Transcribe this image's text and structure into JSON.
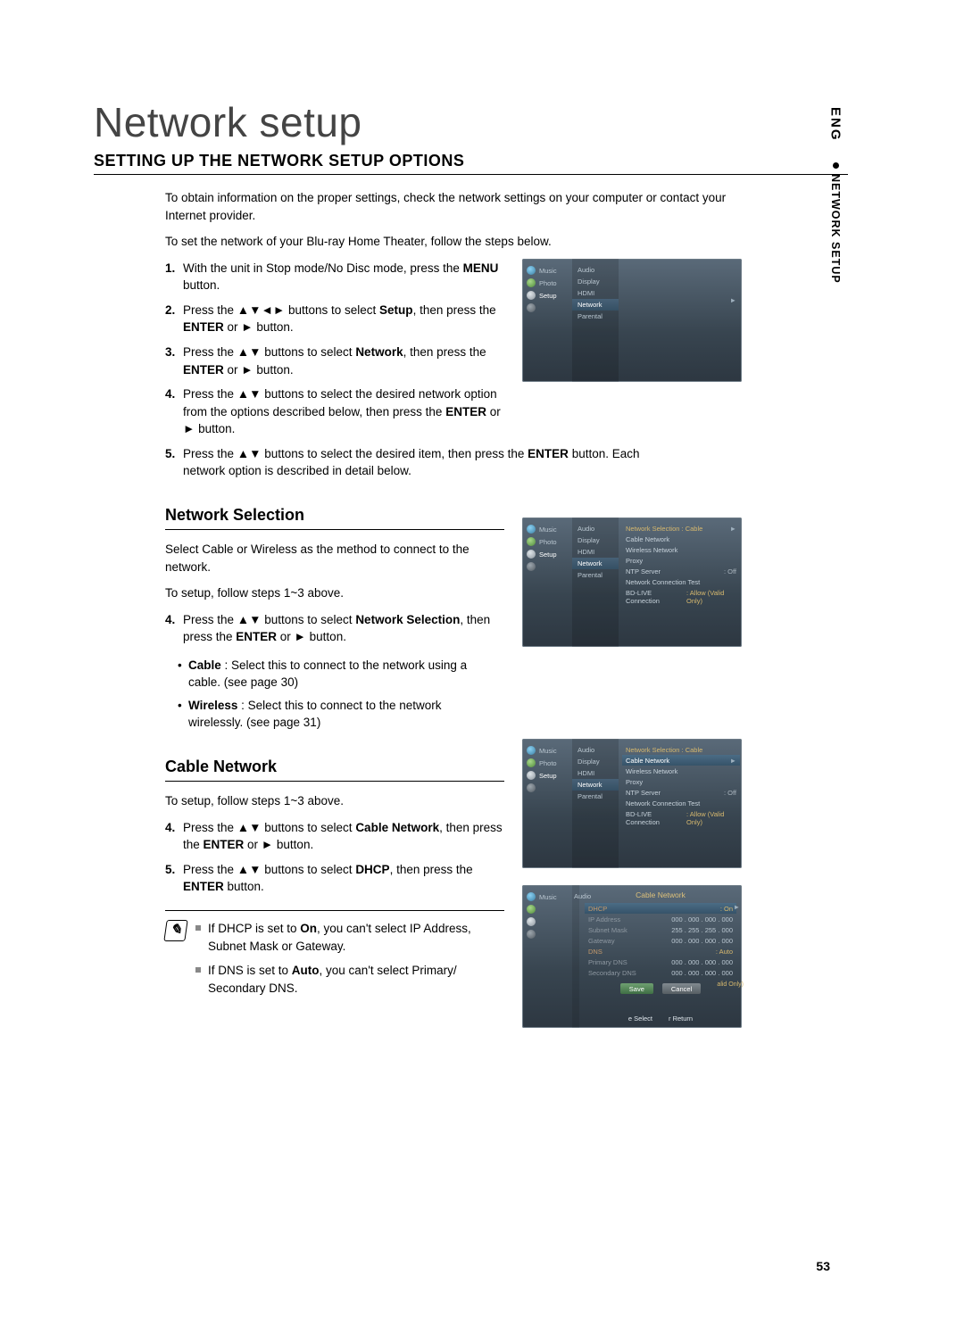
{
  "edge": {
    "lang": "ENG",
    "section": "NETWORK SETUP"
  },
  "title": "Network setup",
  "heading": "SETTING UP THE NETWORK SETUP OPTIONS",
  "intro1": "To obtain information on the proper settings, check the network settings on your computer or contact your Internet provider.",
  "intro2": "To set the network of your Blu-ray Home Theater, follow the steps below.",
  "steps_main": [
    {
      "n": "1.",
      "pre": "With the unit in Stop mode/No Disc mode, press the ",
      "b": "MENU",
      "post": " button."
    },
    {
      "n": "2.",
      "pre": "Press the ▲▼◄► buttons to select ",
      "b": "Setup",
      "post": ", then press the ENTER or ► button.",
      "boldTail": [
        "ENTER"
      ]
    },
    {
      "n": "3.",
      "pre": "Press the ▲▼ buttons to select ",
      "b": "Network",
      "post": ", then press the ENTER or ► button.",
      "boldTail": [
        "ENTER"
      ]
    },
    {
      "n": "4.",
      "pre": "Press the ▲▼ buttons to select the desired network option from the options described below, then press the ",
      "b": "ENTER",
      "post": " or ► button."
    },
    {
      "n": "5.",
      "pre": "Press the ▲▼ buttons to select the desired item, then press the ",
      "b": "ENTER",
      "post": " button. Each network option is described in detail below.",
      "wide": true
    }
  ],
  "net_sel": {
    "heading": "Network Selection",
    "p1": "Select Cable or Wireless as the method to connect to the network.",
    "p2": "To setup, follow steps 1~3 above.",
    "step4_pre": "Press the ▲▼ buttons to select ",
    "step4_b": "Network Selection",
    "step4_post": ", then press the ENTER or ► button.",
    "bullets": [
      {
        "b": "Cable",
        "t": " : Select this to connect to the network using a cable. (see page 30)"
      },
      {
        "b": "Wireless",
        "t": " : Select this to connect to the network wirelessly. (see page 31)"
      }
    ]
  },
  "cable_net": {
    "heading": "Cable Network",
    "p1": "To setup, follow steps 1~3 above.",
    "step4_pre": "Press the ▲▼ buttons to select ",
    "step4_b": "Cable Network",
    "step4_post": ", then press the ENTER or ► button.",
    "step5_pre": "Press the ▲▼ buttons to select ",
    "step5_b": "DHCP",
    "step5_post": ", then press the ENTER button.",
    "notes": [
      {
        "pre": "If DHCP is set to ",
        "b": "On",
        "post": ", you can't select IP Address, Subnet Mask or Gateway."
      },
      {
        "pre": "If DNS is set to ",
        "b": "Auto",
        "post": ", you can't select Primary/ Secondary DNS."
      }
    ]
  },
  "page_number": "53",
  "osd": {
    "leftNav": [
      {
        "icon": "note",
        "label": "Music"
      },
      {
        "icon": "pic",
        "label": "Photo"
      },
      {
        "icon": "gear",
        "label": "Setup"
      },
      {
        "icon": "globe",
        "label": ""
      }
    ],
    "midMenu": [
      "Audio",
      "Display",
      "HDMI",
      "Network",
      "Parental"
    ],
    "s1_right_arrow": "►",
    "s2": {
      "header": "Network Selection :  Cable",
      "items": [
        "Cable Network",
        "Wireless Network",
        "Proxy"
      ],
      "ntp_label": "NTP Server",
      "ntp_val": ": Off",
      "nct": "Network Connection Test",
      "bd_label": "BD-LIVE Connection",
      "bd_val": ": Allow (Valid Only)"
    },
    "s3": {
      "header": "Network Selection :  Cable",
      "sel": "Cable Network",
      "items": [
        "Wireless Network",
        "Proxy"
      ],
      "ntp_label": "NTP Server",
      "ntp_val": ": Off",
      "nct": "Network Connection Test",
      "bd_label": "BD-LIVE Connection",
      "bd_val": ": Allow (Valid Only)"
    },
    "s4": {
      "title": "Cable Network",
      "rows": [
        {
          "l": "DHCP",
          "v": ": On",
          "sel": true
        },
        {
          "l": "IP Address",
          "v": "000 . 000 . 000 . 000",
          "dim": true
        },
        {
          "l": "Subnet Mask",
          "v": "255 . 255 . 255 . 000",
          "dim": true
        },
        {
          "l": "Gateway",
          "v": "000 . 000 . 000 . 000",
          "dim": true
        },
        {
          "l": "DNS",
          "v": ": Auto"
        },
        {
          "l": "Primary DNS",
          "v": "000 . 000 . 000 . 000",
          "dim": true
        },
        {
          "l": "Secondary DNS",
          "v": "000 . 000 . 000 . 000",
          "dim": true
        }
      ],
      "save": "Save",
      "cancel": "Cancel",
      "foot_select": "e Select",
      "foot_return": "r Return",
      "side": "alid Only)"
    }
  }
}
